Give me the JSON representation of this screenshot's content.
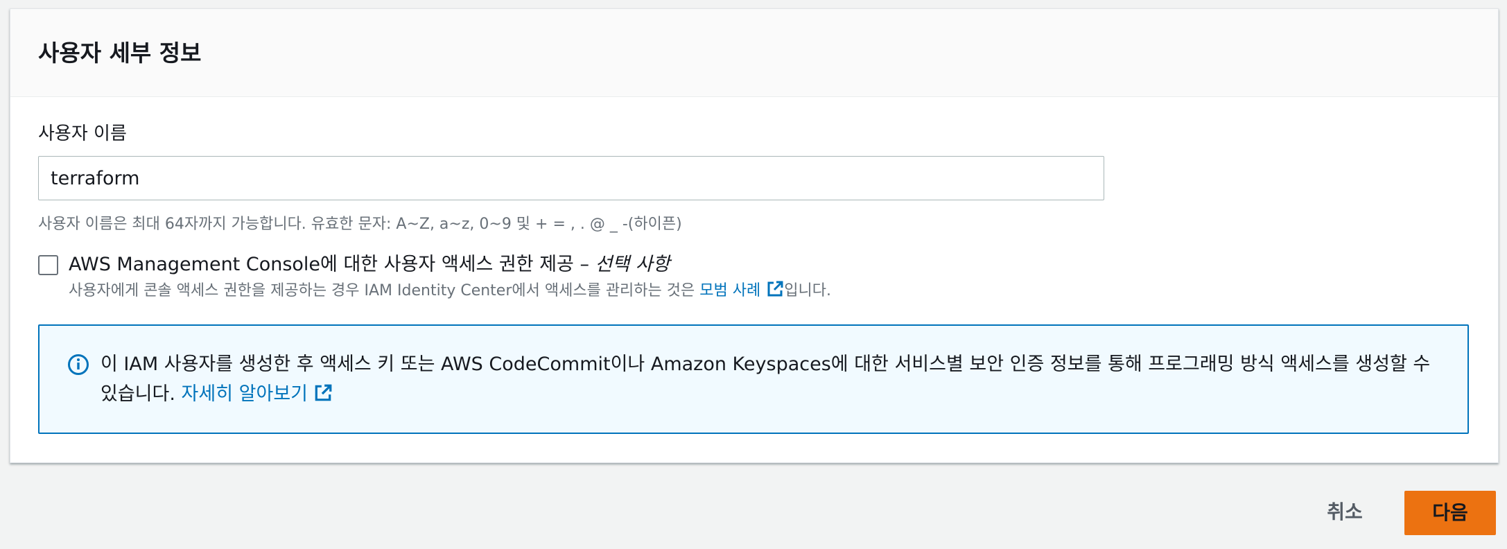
{
  "section": {
    "title": "사용자 세부 정보"
  },
  "username": {
    "label": "사용자 이름",
    "value": "terraform",
    "hint": "사용자 이름은 최대 64자까지 가능합니다. 유효한 문자: A~Z, a~z, 0~9 및 + = , . @ _ -(하이픈)"
  },
  "console_access": {
    "label": "AWS Management Console에 대한 사용자 액세스 권한 제공 – ",
    "optional": "선택 사항",
    "checked": false,
    "description_prefix": "사용자에게 콘솔 액세스 권한을 제공하는 경우 IAM Identity Center에서 액세스를 관리하는 것은 ",
    "description_link": "모범 사례",
    "description_suffix": "입니다."
  },
  "info": {
    "text": "이 IAM 사용자를 생성한 후 액세스 키 또는 AWS CodeCommit이나 Amazon Keyspaces에 대한 서비스별 보안 인증 정보를 통해 프로그래밍 방식 액세스를 생성할 수 있습니다. ",
    "link": "자세히 알아보기"
  },
  "footer": {
    "cancel_label": "취소",
    "next_label": "다음"
  },
  "colors": {
    "primary_button": "#ec7211",
    "link": "#0073bb",
    "info_border": "#0073bb",
    "info_background": "#f1faff"
  },
  "icons": [
    "external-link-icon",
    "info-icon"
  ]
}
